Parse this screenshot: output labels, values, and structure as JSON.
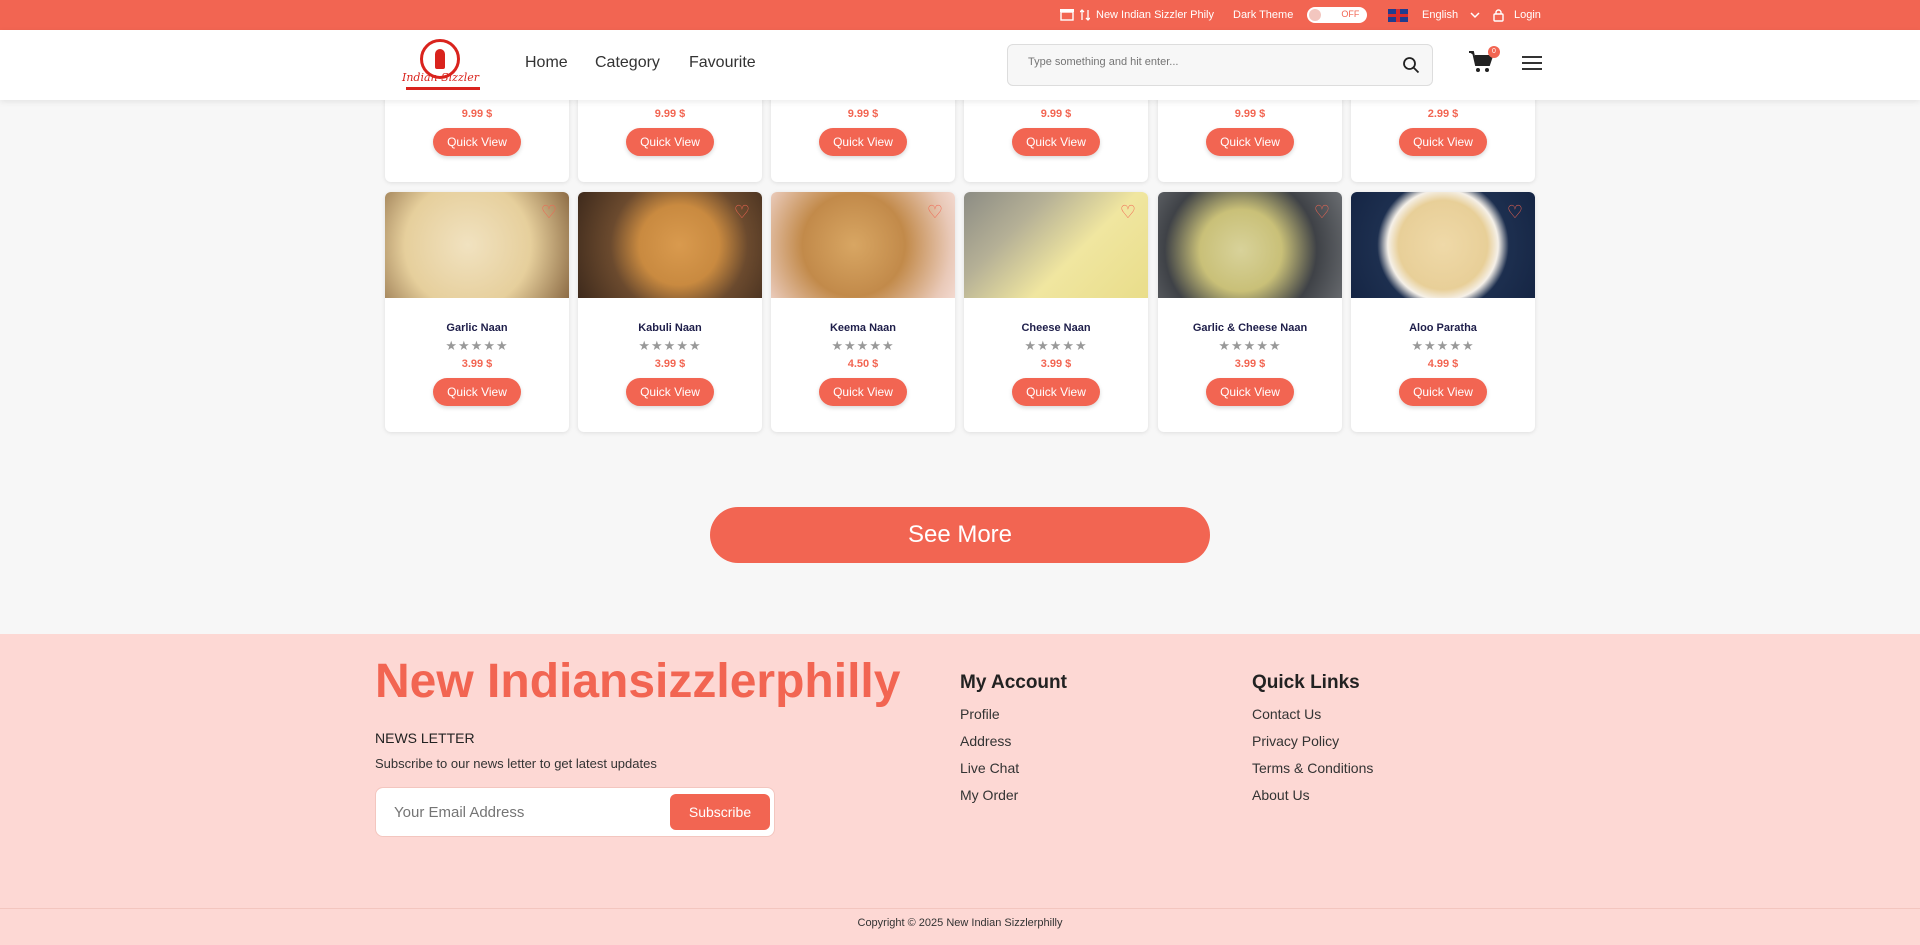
{
  "topbar": {
    "restaurant": "New Indian Sizzler Phily",
    "dark_theme_label": "Dark Theme",
    "dark_theme_state": "OFF",
    "language": "English",
    "login": "Login"
  },
  "header": {
    "logo_text": "Indian Sizzler",
    "nav": [
      "Home",
      "Category",
      "Favourite"
    ],
    "search_placeholder": "Type something and hit enter...",
    "cart_count": "0"
  },
  "products_top": [
    {
      "price": "9.99 $",
      "stars": "★★★★★",
      "action": "Quick View"
    },
    {
      "price": "9.99 $",
      "stars": "★★★★★",
      "action": "Quick View"
    },
    {
      "price": "9.99 $",
      "stars": "★★★★★",
      "action": "Quick View"
    },
    {
      "price": "9.99 $",
      "stars": "★★★★★",
      "action": "Quick View"
    },
    {
      "price": "9.99 $",
      "stars": "★★★★★",
      "action": "Quick View"
    },
    {
      "price": "2.99 $",
      "stars": "★★★★★",
      "action": "Quick View"
    }
  ],
  "products": [
    {
      "name": "Garlic Naan",
      "stars": "★★★★★",
      "price": "3.99 $",
      "action": "Quick View"
    },
    {
      "name": "Kabuli Naan",
      "stars": "★★★★★",
      "price": "3.99 $",
      "action": "Quick View"
    },
    {
      "name": "Keema Naan",
      "stars": "★★★★★",
      "price": "4.50 $",
      "action": "Quick View"
    },
    {
      "name": "Cheese Naan",
      "stars": "★★★★★",
      "price": "3.99 $",
      "action": "Quick View"
    },
    {
      "name": "Garlic & Cheese Naan",
      "stars": "★★★★★",
      "price": "3.99 $",
      "action": "Quick View"
    },
    {
      "name": "Aloo Paratha",
      "stars": "★★★★★",
      "price": "4.99 $",
      "action": "Quick View"
    }
  ],
  "see_more": "See More",
  "footer": {
    "brand": "New Indiansizzlerphilly",
    "newsletter_title": "NEWS LETTER",
    "newsletter_sub": "Subscribe to our news letter to get latest updates",
    "email_placeholder": "Your Email Address",
    "subscribe": "Subscribe",
    "my_account_title": "My Account",
    "my_account": [
      "Profile",
      "Address",
      "Live Chat",
      "My Order"
    ],
    "quick_links_title": "Quick Links",
    "quick_links": [
      "Contact Us",
      "Privacy Policy",
      "Terms & Conditions",
      "About Us"
    ],
    "copyright": "Copyright © 2025 New Indian Sizzlerphilly"
  },
  "colors": {
    "accent": "#f26552",
    "footer_bg": "#fdd8d4",
    "star_empty": "#999999"
  }
}
